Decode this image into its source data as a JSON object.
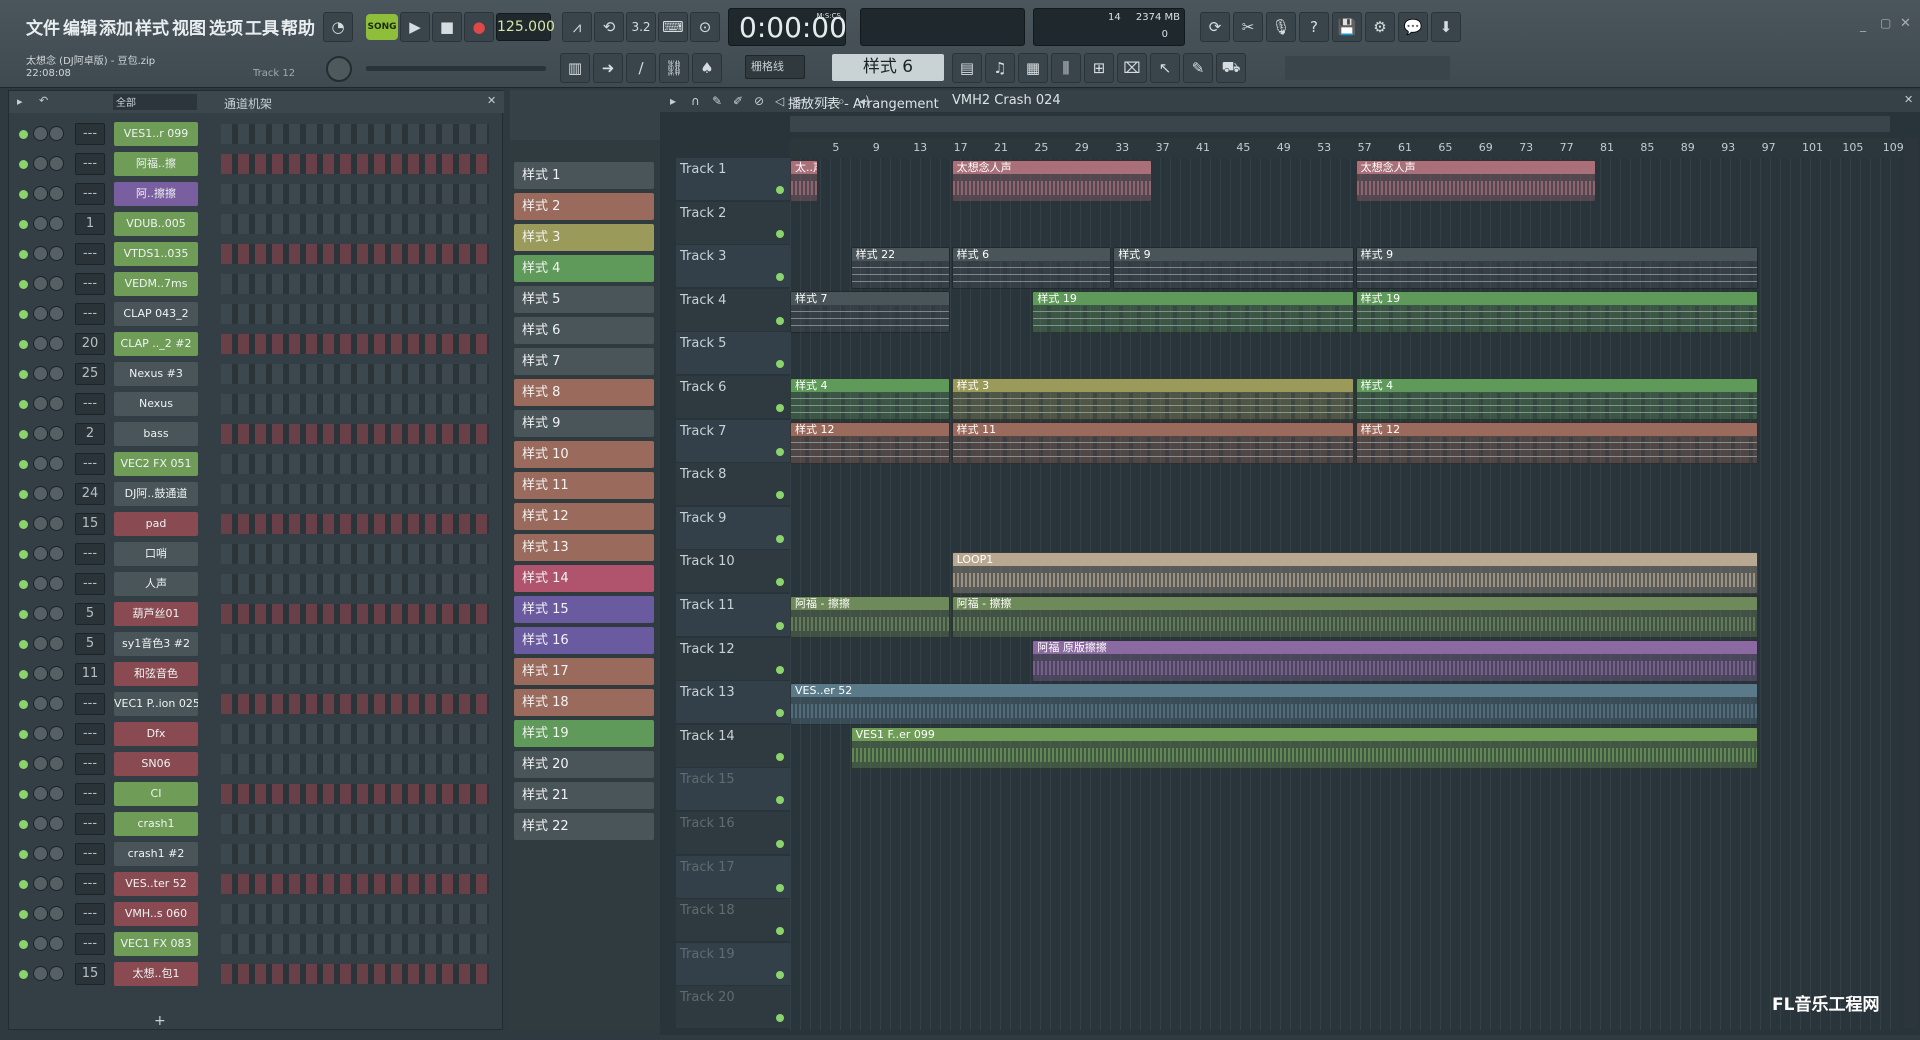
{
  "menu": [
    "文件",
    "编辑",
    "添加",
    "样式",
    "视图",
    "选项",
    "工具",
    "帮助"
  ],
  "song": {
    "title": "太想念 (DJ阿卓版) - 豆包.zip",
    "time": "22:08:08",
    "hint": "Track 12"
  },
  "transport": {
    "mode": "SONG",
    "tempo": "125.000",
    "clock": "0:00:00",
    "clock_label": "M:S:CS",
    "cpu_top": "14",
    "mem": "2374 MB",
    "cpu_bot": "0"
  },
  "snap": "栅格线",
  "pattern_sel": "样式 6",
  "rack": {
    "filter": "全部",
    "title": "通道机架",
    "plus": "+"
  },
  "channels": [
    {
      "n": "---",
      "name": "VES1..r 099",
      "color": "#6f9d57"
    },
    {
      "n": "---",
      "name": "阿福..擦",
      "color": "#6f9d57"
    },
    {
      "n": "---",
      "name": "阿..擦擦",
      "color": "#7a5fa0"
    },
    {
      "n": "1",
      "name": "VDUB..005",
      "color": "#6f9d57"
    },
    {
      "n": "---",
      "name": "VTDS1..035",
      "color": "#6f9d57"
    },
    {
      "n": "---",
      "name": "VEDM..7ms",
      "color": "#6f9d57"
    },
    {
      "n": "---",
      "name": "CLAP 043_2",
      "color": "#4a555a"
    },
    {
      "n": "20",
      "name": "CLAP .._2 #2",
      "color": "#6f9d57"
    },
    {
      "n": "25",
      "name": "Nexus #3",
      "color": "#4a555a"
    },
    {
      "n": "---",
      "name": "Nexus",
      "color": "#4a555a"
    },
    {
      "n": "2",
      "name": "bass",
      "color": "#4a555a"
    },
    {
      "n": "---",
      "name": "VEC2 FX 051",
      "color": "#6f9d57"
    },
    {
      "n": "24",
      "name": "DJ阿..鼓通道",
      "color": "#4a555a"
    },
    {
      "n": "15",
      "name": "pad",
      "color": "#8a4a52"
    },
    {
      "n": "---",
      "name": "口哨",
      "color": "#4a555a"
    },
    {
      "n": "---",
      "name": "人声",
      "color": "#4a555a"
    },
    {
      "n": "5",
      "name": "葫芦丝01",
      "color": "#8a4a52"
    },
    {
      "n": "5",
      "name": "sy1音色3 #2",
      "color": "#4a555a"
    },
    {
      "n": "11",
      "name": "和弦音色",
      "color": "#8a4a52"
    },
    {
      "n": "---",
      "name": "VEC1 P..ion 025",
      "color": "#4a555a"
    },
    {
      "n": "---",
      "name": "Dfx",
      "color": "#8a4a52"
    },
    {
      "n": "---",
      "name": "SN06",
      "color": "#8a4a52"
    },
    {
      "n": "---",
      "name": "CI",
      "color": "#6f9d57"
    },
    {
      "n": "---",
      "name": "crash1",
      "color": "#6f9d57"
    },
    {
      "n": "---",
      "name": "crash1 #2",
      "color": "#4a555a"
    },
    {
      "n": "---",
      "name": "VES..ter 52",
      "color": "#8a4a52"
    },
    {
      "n": "---",
      "name": "VMH..s 060",
      "color": "#8a4a52"
    },
    {
      "n": "---",
      "name": "VEC1 FX 083",
      "color": "#6f9d57"
    },
    {
      "n": "15",
      "name": "太想..包1",
      "color": "#8a4a52"
    }
  ],
  "patterns": [
    {
      "name": "样式 1",
      "color": "#4a555a"
    },
    {
      "name": "样式 2",
      "color": "#9a6a5c"
    },
    {
      "name": "样式 3",
      "color": "#9a9a5a"
    },
    {
      "name": "样式 4",
      "color": "#5f9a5a"
    },
    {
      "name": "样式 5",
      "color": "#4a555a"
    },
    {
      "name": "样式 6",
      "color": "#4a555a"
    },
    {
      "name": "样式 7",
      "color": "#4a555a"
    },
    {
      "name": "样式 8",
      "color": "#9a6a5c"
    },
    {
      "name": "样式 9",
      "color": "#4a555a"
    },
    {
      "name": "样式 10",
      "color": "#9a6a5c"
    },
    {
      "name": "样式 11",
      "color": "#9a6a5c"
    },
    {
      "name": "样式 12",
      "color": "#9a6a5c"
    },
    {
      "name": "样式 13",
      "color": "#9a6a5c"
    },
    {
      "name": "样式 14",
      "color": "#b0546e"
    },
    {
      "name": "样式 15",
      "color": "#6a5ba0"
    },
    {
      "name": "样式 16",
      "color": "#6a5ba0"
    },
    {
      "name": "样式 17",
      "color": "#9a6a5c"
    },
    {
      "name": "样式 18",
      "color": "#9a6a5c"
    },
    {
      "name": "样式 19",
      "color": "#5f9a5a"
    },
    {
      "name": "样式 20",
      "color": "#4a555a"
    },
    {
      "name": "样式 21",
      "color": "#4a555a"
    },
    {
      "name": "样式 22",
      "color": "#4a555a"
    }
  ],
  "playlist": {
    "title": "播放列表 - Arrangement",
    "crumb": "VMH2 Crash 024"
  },
  "ruler": [
    "5",
    "9",
    "13",
    "17",
    "21",
    "25",
    "29",
    "33",
    "37",
    "41",
    "45",
    "49",
    "53",
    "57",
    "61",
    "65",
    "69",
    "73",
    "77",
    "81",
    "85",
    "89",
    "93",
    "97",
    "101",
    "105",
    "109"
  ],
  "tracks": [
    "Track 1",
    "Track 2",
    "Track 3",
    "Track 4",
    "Track 5",
    "Track 6",
    "Track 7",
    "Track 8",
    "Track 9",
    "Track 10",
    "Track 11",
    "Track 12",
    "Track 13",
    "Track 14",
    "Track 15",
    "Track 16",
    "Track 17",
    "Track 18",
    "Track 19",
    "Track 20"
  ],
  "clips": [
    {
      "t": 0,
      "s": 1,
      "e": 4,
      "label": "太..声",
      "kind": "audio",
      "color": "#a9707a"
    },
    {
      "t": 0,
      "s": 17,
      "e": 37,
      "label": "太想念人声",
      "kind": "audio",
      "color": "#a9707a"
    },
    {
      "t": 0,
      "s": 57,
      "e": 81,
      "label": "太想念人声",
      "kind": "audio",
      "color": "#a9707a"
    },
    {
      "t": 2,
      "s": 7,
      "e": 17,
      "label": "样式 22",
      "kind": "pat",
      "color": "#4a555a"
    },
    {
      "t": 2,
      "s": 17,
      "e": 33,
      "label": "样式 6",
      "kind": "pat",
      "color": "#4a555a"
    },
    {
      "t": 2,
      "s": 33,
      "e": 57,
      "label": "样式 9",
      "kind": "pat",
      "color": "#4a555a"
    },
    {
      "t": 2,
      "s": 57,
      "e": 97,
      "label": "样式 9",
      "kind": "pat",
      "color": "#4a555a"
    },
    {
      "t": 3,
      "s": 1,
      "e": 17,
      "label": "样式 7",
      "kind": "pat",
      "color": "#4a555a"
    },
    {
      "t": 3,
      "s": 25,
      "e": 57,
      "label": "样式 19",
      "kind": "pat",
      "color": "#5f9a5a"
    },
    {
      "t": 3,
      "s": 57,
      "e": 97,
      "label": "样式 19",
      "kind": "pat",
      "color": "#5f9a5a"
    },
    {
      "t": 5,
      "s": 1,
      "e": 17,
      "label": "样式 4",
      "kind": "pat",
      "color": "#5f9a5a"
    },
    {
      "t": 5,
      "s": 17,
      "e": 57,
      "label": "样式 3",
      "kind": "pat",
      "color": "#9a9a5a"
    },
    {
      "t": 5,
      "s": 57,
      "e": 97,
      "label": "样式 4",
      "kind": "pat",
      "color": "#5f9a5a"
    },
    {
      "t": 6,
      "s": 1,
      "e": 17,
      "label": "样式 12",
      "kind": "pat",
      "color": "#9a6a5c"
    },
    {
      "t": 6,
      "s": 17,
      "e": 57,
      "label": "样式 11",
      "kind": "pat",
      "color": "#9a6a5c"
    },
    {
      "t": 6,
      "s": 57,
      "e": 97,
      "label": "样式 12",
      "kind": "pat",
      "color": "#9a6a5c"
    },
    {
      "t": 9,
      "s": 17,
      "e": 97,
      "label": "LOOP1",
      "kind": "audio",
      "color": "#b8a892"
    },
    {
      "t": 10,
      "s": 1,
      "e": 17,
      "label": "阿福 - 擦擦",
      "kind": "audio",
      "color": "#6f8a5a"
    },
    {
      "t": 10,
      "s": 17,
      "e": 97,
      "label": "阿福 - 擦擦",
      "kind": "audio",
      "color": "#6f8a5a"
    },
    {
      "t": 11,
      "s": 25,
      "e": 97,
      "label": "阿福 原版擦擦",
      "kind": "audio",
      "color": "#8a6aa0"
    },
    {
      "t": 12,
      "s": 1,
      "e": 97,
      "label": "VES..er 52",
      "kind": "audio",
      "color": "#5a7a8a"
    },
    {
      "t": 13,
      "s": 7,
      "e": 97,
      "label": "VES1 F..er 099",
      "kind": "audio",
      "color": "#6f9d57"
    }
  ],
  "watermark": "FL音乐工程网"
}
